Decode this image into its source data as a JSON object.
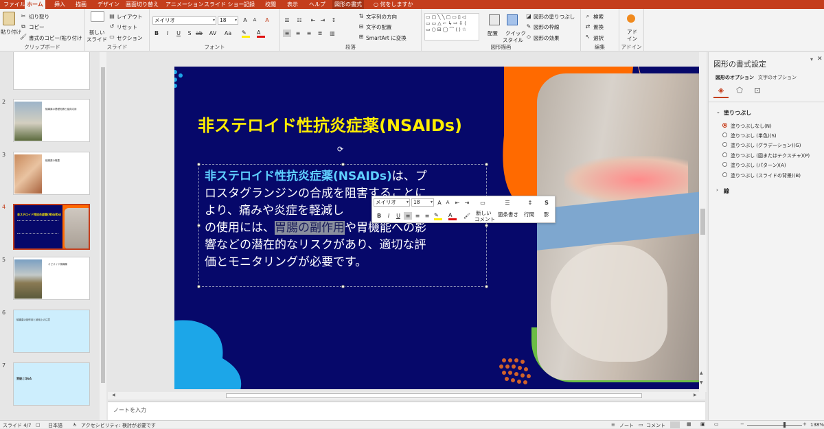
{
  "tabs": [
    "ファイル",
    "ホーム",
    "挿入",
    "描画",
    "デザイン",
    "画面切り替え",
    "アニメーション",
    "スライド ショー",
    "記録",
    "校閲",
    "表示",
    "ヘルプ",
    "図形の書式",
    "何をしますか"
  ],
  "ribbon": {
    "clipboard": {
      "paste": "貼り付け",
      "cut": "切り取り",
      "copy": "コピー",
      "format_painter": "書式のコピー/貼り付け",
      "label": "クリップボード"
    },
    "slides": {
      "new_slide": "新しい",
      "new_slide2": "スライド",
      "layout": "レイアウト",
      "reset": "リセット",
      "section": "セクション",
      "label": "スライド"
    },
    "font": {
      "name": "メイリオ",
      "size": "18",
      "label": "フォント",
      "bold": "B",
      "italic": "I",
      "underline": "U",
      "strike": "S",
      "shadow": "ab",
      "spacing": "AV",
      "case": "Aa"
    },
    "paragraph": {
      "text_direction": "文字列の方向",
      "align_text": "文字の配置",
      "smartart": "SmartArt に変換",
      "label": "段落"
    },
    "drawing": {
      "arrange": "配置",
      "quick_styles": "クイック",
      "quick_styles2": "スタイル",
      "fill": "図形の塗りつぶし",
      "outline": "図形の枠線",
      "effects": "図形の効果",
      "label": "図形描画"
    },
    "editing": {
      "find": "検索",
      "replace": "置換",
      "select": "選択",
      "label": "編集"
    },
    "addins": {
      "name": "アド",
      "name2": "イン",
      "label": "アドイン"
    }
  },
  "thumbnails": [
    {
      "num": "2",
      "title": "鎮痛薬の基礎知識と臨床応用"
    },
    {
      "num": "3",
      "title": "鎮痛薬の概要"
    },
    {
      "num": "4",
      "title": "非ステロイド性抗炎症薬(NSAIDs)"
    },
    {
      "num": "5",
      "title": "オピオイド鎮痛薬"
    },
    {
      "num": "6",
      "title": "鎮痛薬の副作用と使用上の注意"
    },
    {
      "num": "7",
      "title": "質疑とQ&A"
    }
  ],
  "slide": {
    "title": "非ステロイド性抗炎症薬(NSAIDs)",
    "body_bold": "非ステロイド性抗炎症薬(NSAIDs)",
    "body_line1": "は、プ",
    "body_line2": "ロスタグランジンの合成を阻害することに",
    "body_line3": "より、痛みや炎症を軽減し",
    "body_line4a": "の使用には、",
    "body_selected": "胃腸の副作用",
    "body_line4b": "や胃機能への影",
    "body_line5": "響などの潜在的なリスクがあり、適切な評",
    "body_line6": "価とモニタリングが必要です。"
  },
  "minitoolbar": {
    "font": "メイリオ",
    "size": "18",
    "new_comment": "新しい",
    "new_comment2": "コメント",
    "bullets": "箇条書き",
    "line_spacing": "行間",
    "shadow": "影"
  },
  "notes": {
    "placeholder": "ノートを入力"
  },
  "format_pane": {
    "title": "図形の書式設定",
    "tab_shape": "図形のオプション",
    "tab_text": "文字のオプション",
    "fill_section": "塗りつぶし",
    "options": [
      "塗りつぶしなし(N)",
      "塗りつぶし (単色)(S)",
      "塗りつぶし (グラデーション)(G)",
      "塗りつぶし (図またはテクスチャ)(P)",
      "塗りつぶし (パターン)(A)",
      "塗りつぶし (スライドの背景)(B)"
    ],
    "selected_index": 0,
    "line_section": "線"
  },
  "status": {
    "slide": "スライド 4/7",
    "language": "日本語",
    "accessibility": "アクセシビリティ: 検討が必要です",
    "notes": "ノート",
    "comments": "コメント",
    "zoom": "138%"
  },
  "colors": {
    "accent": "#c43e1c",
    "slide_bg": "#06086a",
    "title": "#ffee00",
    "body_bold": "#5fd0ff",
    "orange": "#ff6a00",
    "blue": "#1ca6e8",
    "green": "#6bbd45"
  }
}
